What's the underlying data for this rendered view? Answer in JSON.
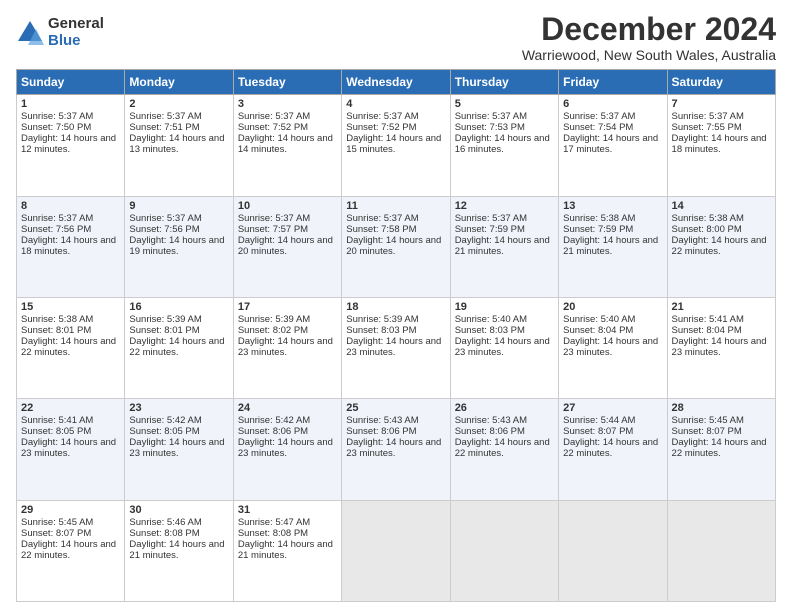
{
  "logo": {
    "general": "General",
    "blue": "Blue"
  },
  "header": {
    "month": "December 2024",
    "location": "Warriewood, New South Wales, Australia"
  },
  "weekdays": [
    "Sunday",
    "Monday",
    "Tuesday",
    "Wednesday",
    "Thursday",
    "Friday",
    "Saturday"
  ],
  "weeks": [
    [
      {
        "day": "1",
        "sunrise": "5:37 AM",
        "sunset": "7:50 PM",
        "daylight": "14 hours and 12 minutes."
      },
      {
        "day": "2",
        "sunrise": "5:37 AM",
        "sunset": "7:51 PM",
        "daylight": "14 hours and 13 minutes."
      },
      {
        "day": "3",
        "sunrise": "5:37 AM",
        "sunset": "7:52 PM",
        "daylight": "14 hours and 14 minutes."
      },
      {
        "day": "4",
        "sunrise": "5:37 AM",
        "sunset": "7:52 PM",
        "daylight": "14 hours and 15 minutes."
      },
      {
        "day": "5",
        "sunrise": "5:37 AM",
        "sunset": "7:53 PM",
        "daylight": "14 hours and 16 minutes."
      },
      {
        "day": "6",
        "sunrise": "5:37 AM",
        "sunset": "7:54 PM",
        "daylight": "14 hours and 17 minutes."
      },
      {
        "day": "7",
        "sunrise": "5:37 AM",
        "sunset": "7:55 PM",
        "daylight": "14 hours and 18 minutes."
      }
    ],
    [
      {
        "day": "8",
        "sunrise": "5:37 AM",
        "sunset": "7:56 PM",
        "daylight": "14 hours and 18 minutes."
      },
      {
        "day": "9",
        "sunrise": "5:37 AM",
        "sunset": "7:56 PM",
        "daylight": "14 hours and 19 minutes."
      },
      {
        "day": "10",
        "sunrise": "5:37 AM",
        "sunset": "7:57 PM",
        "daylight": "14 hours and 20 minutes."
      },
      {
        "day": "11",
        "sunrise": "5:37 AM",
        "sunset": "7:58 PM",
        "daylight": "14 hours and 20 minutes."
      },
      {
        "day": "12",
        "sunrise": "5:37 AM",
        "sunset": "7:59 PM",
        "daylight": "14 hours and 21 minutes."
      },
      {
        "day": "13",
        "sunrise": "5:38 AM",
        "sunset": "7:59 PM",
        "daylight": "14 hours and 21 minutes."
      },
      {
        "day": "14",
        "sunrise": "5:38 AM",
        "sunset": "8:00 PM",
        "daylight": "14 hours and 22 minutes."
      }
    ],
    [
      {
        "day": "15",
        "sunrise": "5:38 AM",
        "sunset": "8:01 PM",
        "daylight": "14 hours and 22 minutes."
      },
      {
        "day": "16",
        "sunrise": "5:39 AM",
        "sunset": "8:01 PM",
        "daylight": "14 hours and 22 minutes."
      },
      {
        "day": "17",
        "sunrise": "5:39 AM",
        "sunset": "8:02 PM",
        "daylight": "14 hours and 23 minutes."
      },
      {
        "day": "18",
        "sunrise": "5:39 AM",
        "sunset": "8:03 PM",
        "daylight": "14 hours and 23 minutes."
      },
      {
        "day": "19",
        "sunrise": "5:40 AM",
        "sunset": "8:03 PM",
        "daylight": "14 hours and 23 minutes."
      },
      {
        "day": "20",
        "sunrise": "5:40 AM",
        "sunset": "8:04 PM",
        "daylight": "14 hours and 23 minutes."
      },
      {
        "day": "21",
        "sunrise": "5:41 AM",
        "sunset": "8:04 PM",
        "daylight": "14 hours and 23 minutes."
      }
    ],
    [
      {
        "day": "22",
        "sunrise": "5:41 AM",
        "sunset": "8:05 PM",
        "daylight": "14 hours and 23 minutes."
      },
      {
        "day": "23",
        "sunrise": "5:42 AM",
        "sunset": "8:05 PM",
        "daylight": "14 hours and 23 minutes."
      },
      {
        "day": "24",
        "sunrise": "5:42 AM",
        "sunset": "8:06 PM",
        "daylight": "14 hours and 23 minutes."
      },
      {
        "day": "25",
        "sunrise": "5:43 AM",
        "sunset": "8:06 PM",
        "daylight": "14 hours and 23 minutes."
      },
      {
        "day": "26",
        "sunrise": "5:43 AM",
        "sunset": "8:06 PM",
        "daylight": "14 hours and 22 minutes."
      },
      {
        "day": "27",
        "sunrise": "5:44 AM",
        "sunset": "8:07 PM",
        "daylight": "14 hours and 22 minutes."
      },
      {
        "day": "28",
        "sunrise": "5:45 AM",
        "sunset": "8:07 PM",
        "daylight": "14 hours and 22 minutes."
      }
    ],
    [
      {
        "day": "29",
        "sunrise": "5:45 AM",
        "sunset": "8:07 PM",
        "daylight": "14 hours and 22 minutes."
      },
      {
        "day": "30",
        "sunrise": "5:46 AM",
        "sunset": "8:08 PM",
        "daylight": "14 hours and 21 minutes."
      },
      {
        "day": "31",
        "sunrise": "5:47 AM",
        "sunset": "8:08 PM",
        "daylight": "14 hours and 21 minutes."
      },
      null,
      null,
      null,
      null
    ]
  ]
}
